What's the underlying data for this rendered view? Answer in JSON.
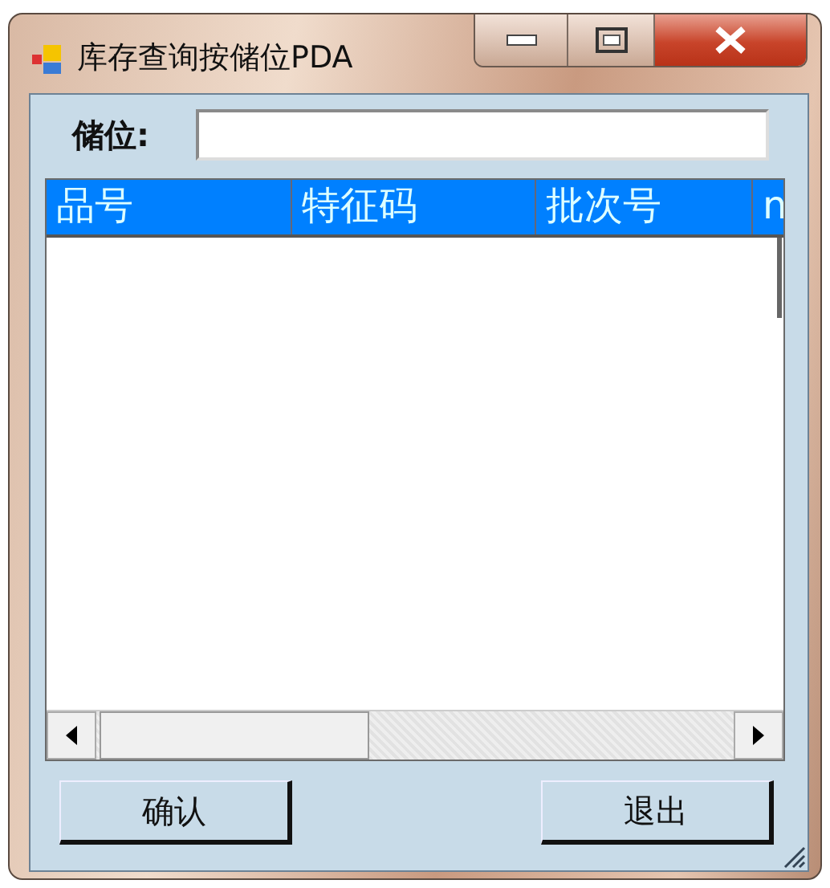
{
  "window": {
    "title": "库存查询按储位PDA"
  },
  "location_field": {
    "label": "储位:"
  },
  "table": {
    "columns": [
      "品号",
      "特征码",
      "批次号",
      "n"
    ]
  },
  "buttons": [
    "确认",
    "退出"
  ]
}
